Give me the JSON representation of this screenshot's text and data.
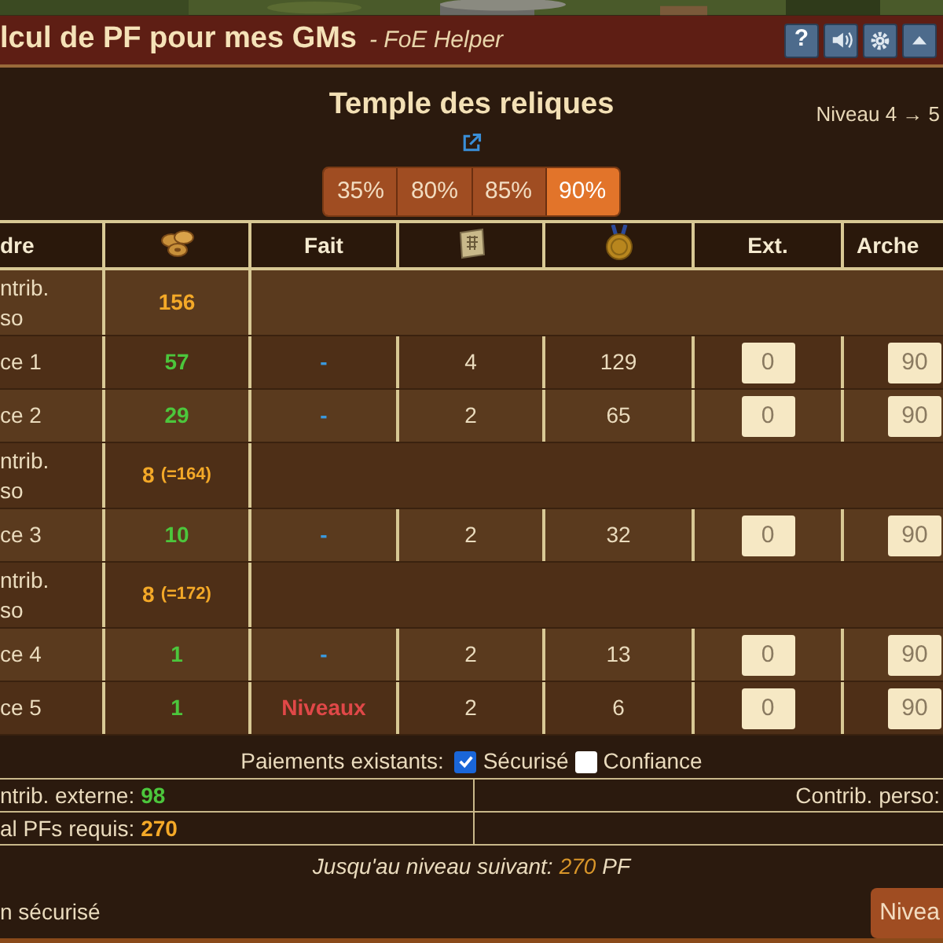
{
  "window": {
    "title": "lcul de PF pour mes GMs",
    "subtitle": "- FoE Helper"
  },
  "title_buttons": [
    {
      "kind": "help",
      "label": "?"
    },
    {
      "kind": "sound"
    },
    {
      "kind": "settings"
    },
    {
      "kind": "collapse"
    }
  ],
  "building": {
    "name": "Temple des reliques",
    "level": "Niveau 4 → 5"
  },
  "percent_buttons": [
    {
      "label": "35%",
      "selected": false
    },
    {
      "label": "80%",
      "selected": false
    },
    {
      "label": "85%",
      "selected": false
    },
    {
      "label": "90%",
      "selected": true
    }
  ],
  "table": {
    "columns": [
      {
        "kind": "text",
        "label": "dre"
      },
      {
        "kind": "coins"
      },
      {
        "kind": "text",
        "label": "Fait"
      },
      {
        "kind": "blueprint"
      },
      {
        "kind": "medal"
      },
      {
        "kind": "text",
        "label": "Ext."
      },
      {
        "kind": "text",
        "label": "Arche"
      }
    ],
    "rows": [
      {
        "kind": "own",
        "label": "ntrib. so",
        "pf": "156"
      },
      {
        "kind": "place",
        "label": "ce 1",
        "pf": "57",
        "done": {
          "kind": "pending",
          "text": "-"
        },
        "blueprints": "4",
        "medals": "129",
        "ext": "0",
        "arche": "90"
      },
      {
        "kind": "place",
        "label": "ce 2",
        "pf": "29",
        "done": {
          "kind": "pending",
          "text": "-"
        },
        "blueprints": "2",
        "medals": "65",
        "ext": "0",
        "arche": "90"
      },
      {
        "kind": "own",
        "label": "ntrib. so",
        "pf": "8",
        "total": "(=164)"
      },
      {
        "kind": "place",
        "label": "ce 3",
        "pf": "10",
        "done": {
          "kind": "pending",
          "text": "-"
        },
        "blueprints": "2",
        "medals": "32",
        "ext": "0",
        "arche": "90"
      },
      {
        "kind": "own",
        "label": "ntrib. so",
        "pf": "8",
        "total": "(=172)"
      },
      {
        "kind": "place",
        "label": "ce 4",
        "pf": "1",
        "done": {
          "kind": "pending",
          "text": "-"
        },
        "blueprints": "2",
        "medals": "13",
        "ext": "0",
        "arche": "90"
      },
      {
        "kind": "place",
        "label": "ce 5",
        "pf": "1",
        "done": {
          "kind": "levels",
          "text": "Niveaux"
        },
        "blueprints": "2",
        "medals": "6",
        "ext": "0",
        "arche": "90"
      }
    ]
  },
  "payments": {
    "label": "Paiements existants:",
    "options": [
      {
        "label": "Sécurisé",
        "checked": true
      },
      {
        "label": "Confiance",
        "checked": false
      }
    ]
  },
  "summary": [
    {
      "left": {
        "label": "ntrib. externe:",
        "value": "98",
        "kind": "external"
      },
      "right": {
        "label": "Contrib. perso:"
      }
    },
    {
      "left": {
        "label": "al PFs requis:",
        "value": "270",
        "kind": "required"
      }
    }
  ],
  "next_level": {
    "label": "Jusqu'au niveau suivant:",
    "value": "270",
    "unit": "PF"
  },
  "footer": {
    "text": "n sécurisé",
    "button": "Nivea"
  }
}
